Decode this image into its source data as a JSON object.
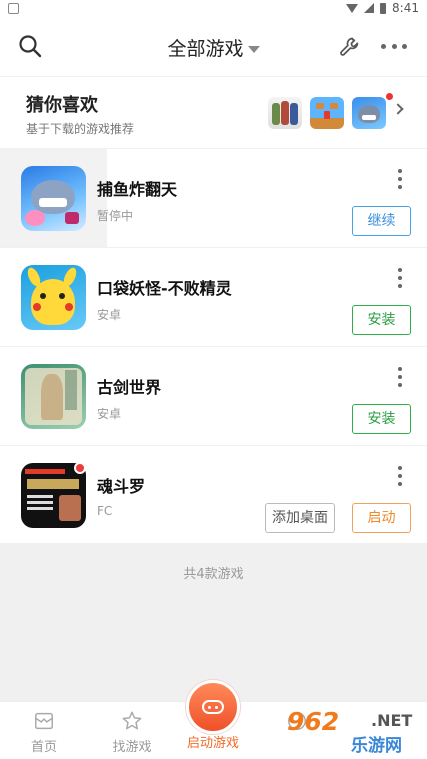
{
  "status_bar": {
    "time": "8:41"
  },
  "header": {
    "title": "全部游戏"
  },
  "recommend": {
    "title": "猜你喜欢",
    "subtitle": "基于下载的游戏推荐"
  },
  "games": [
    {
      "name": "捕鱼炸翻天",
      "status": "暂停中",
      "buttons": [
        "继续"
      ]
    },
    {
      "name": "口袋妖怪-不败精灵",
      "status": "安卓",
      "buttons": [
        "安装"
      ]
    },
    {
      "name": "古剑世界",
      "status": "安卓",
      "buttons": [
        "安装"
      ]
    },
    {
      "name": "魂斗罗",
      "status": "FC",
      "buttons": [
        "添加桌面",
        "启动"
      ]
    }
  ],
  "summary": {
    "total_text": "共4款游戏"
  },
  "tabbar": {
    "home": "首页",
    "find": "找游戏",
    "launch": "启动游戏"
  },
  "watermark": {
    "number": "962",
    "net": ".NET",
    "site": "乐游网"
  },
  "colors": {
    "accent_orange": "#f06b2a",
    "continue_blue": "#3a92dc",
    "install_green": "#2a9d43"
  }
}
